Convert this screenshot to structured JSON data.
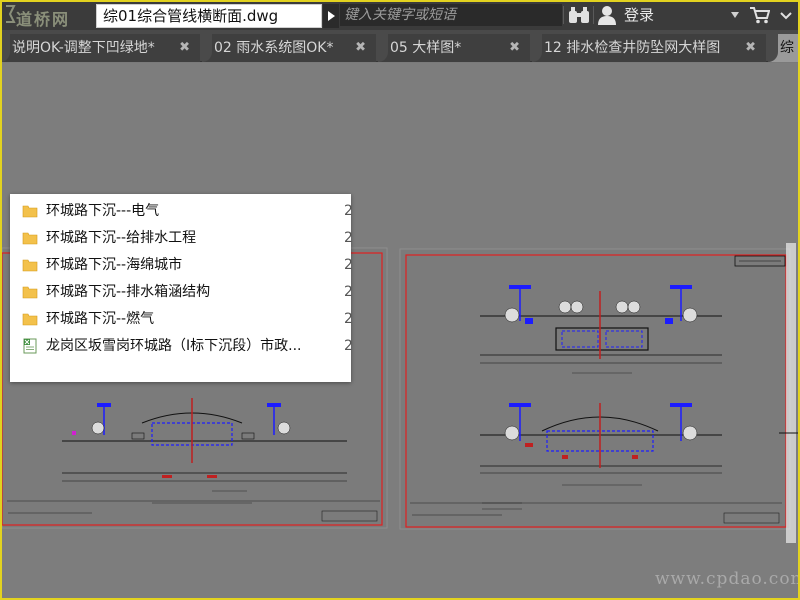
{
  "titlebar": {
    "logo_text": "道桥网",
    "document_title": "综01综合管线横断面.dwg",
    "search_placeholder": "键入关键字或短语",
    "login_label": "登录"
  },
  "tabs": [
    {
      "label": "说明OK-调整下凹绿地*"
    },
    {
      "label": "02 雨水系统图OK*"
    },
    {
      "label": "05 大样图*"
    },
    {
      "label": "12 排水检查井防坠网大样图"
    },
    {
      "label": "综"
    }
  ],
  "tab_close_glyph": "✖",
  "files": [
    {
      "name": "环城路下沉---电气",
      "type": "folder",
      "date": "2"
    },
    {
      "name": "环城路下沉--给排水工程",
      "type": "folder",
      "date": "2"
    },
    {
      "name": "环城路下沉--海绵城市",
      "type": "folder",
      "date": "2"
    },
    {
      "name": "环城路下沉--排水箱涵结构",
      "type": "folder",
      "date": "2"
    },
    {
      "name": "环城路下沉--燃气",
      "type": "folder",
      "date": "2"
    },
    {
      "name": "龙岗区坂雪岗环城路（Ⅰ标下沉段）市政...",
      "type": "spreadsheet",
      "date": "2"
    }
  ],
  "watermark": "www.cpdao.com",
  "colors": {
    "frame": "#e2d21f",
    "sheet_border": "#e02020",
    "folder": "#f3c14b",
    "pipe_blue": "#1c1cff"
  }
}
